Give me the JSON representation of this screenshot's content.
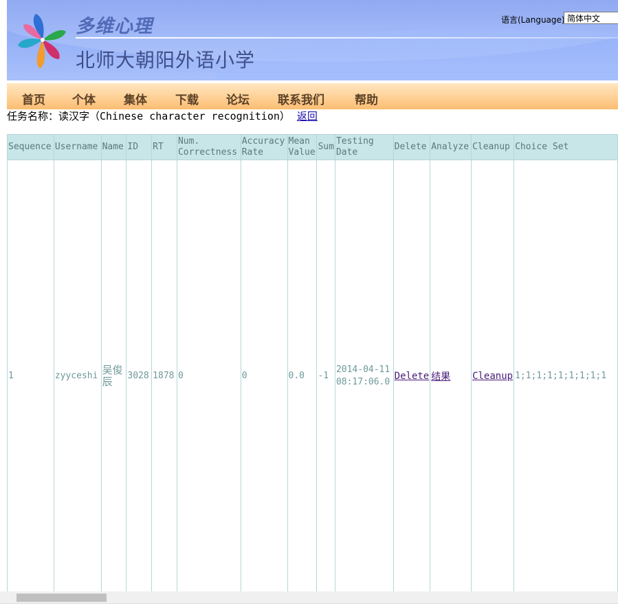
{
  "header": {
    "subtitle": "多维心理",
    "school_name": "北师大朝阳外语小学",
    "language_label": "语言(Language)",
    "language_selected": "简体中文"
  },
  "nav": {
    "items": [
      "首页",
      "个体",
      "集体",
      "下载",
      "论坛",
      "联系我们",
      "帮助"
    ]
  },
  "task": {
    "label": "任务名称：读汉字（Chinese character recognition）",
    "back_link": "返回"
  },
  "table": {
    "headers": [
      "Sequence",
      "Username",
      "Name",
      "ID",
      "RT",
      "Num. Correctness",
      "Accuracy Rate",
      "Mean Value",
      "Sum",
      "Testing Date",
      "Delete",
      "Analyze",
      "Cleanup",
      "Choice Set"
    ],
    "row": {
      "sequence": "1",
      "username": "zyyceshi",
      "name": "吴俊辰",
      "id": "3028",
      "rt": "1878",
      "num_correctness": "0",
      "accuracy_rate": "0",
      "mean_value": "0.0",
      "sum": "-1",
      "testing_date": "2014-04-11 08:17:06.0",
      "delete": "Delete",
      "analyze": "结果",
      "cleanup": "Cleanup",
      "choice_set": "1;1;1;1;1;1;1;1;1"
    }
  },
  "colors": {
    "banner": "#8fabf6",
    "navbar": "#ffd39a",
    "table_header": "#c8e5e7",
    "table_text": "#6f9898",
    "link": "#4a1a7a"
  }
}
